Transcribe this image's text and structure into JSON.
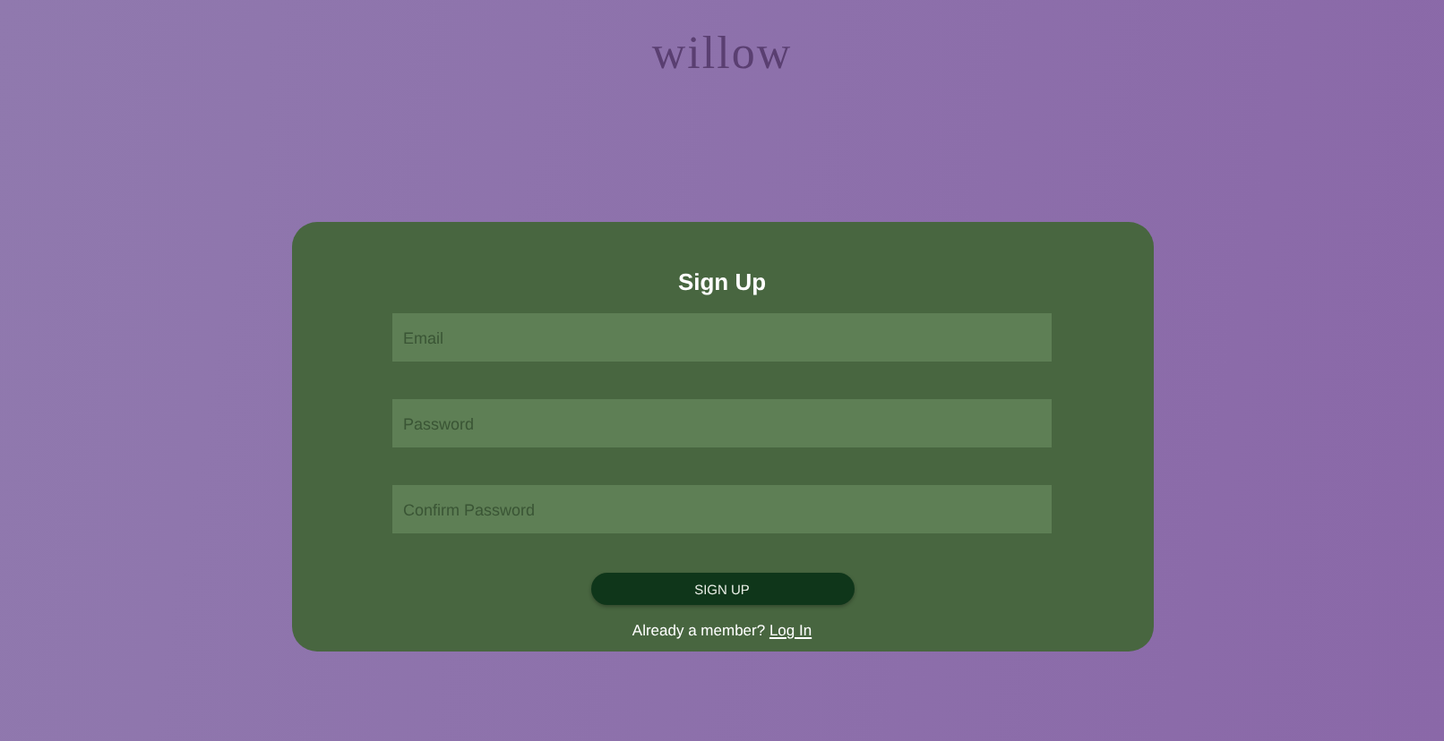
{
  "logo": "willow",
  "form": {
    "title": "Sign Up",
    "fields": [
      {
        "placeholder": "Email"
      },
      {
        "placeholder": "Password"
      },
      {
        "placeholder": "Confirm Password"
      }
    ],
    "submit": "SIGN UP",
    "footer": {
      "text": "Already a member?",
      "link": "Log In"
    }
  }
}
